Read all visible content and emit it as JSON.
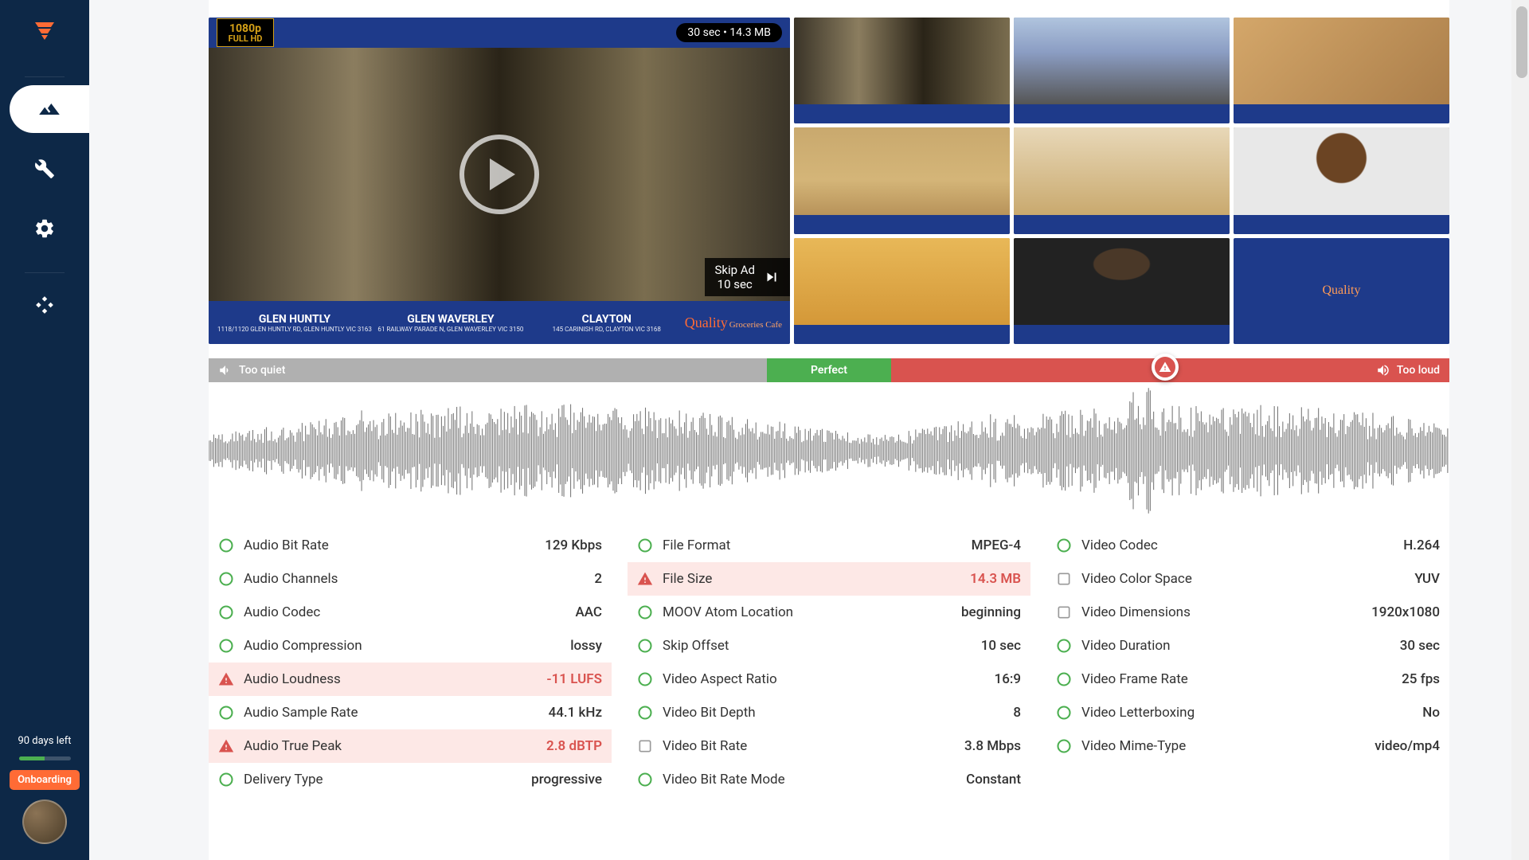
{
  "sidebar": {
    "days_left": "90 days left",
    "onboarding": "Onboarding"
  },
  "video": {
    "hd_top": "1080p",
    "hd_bottom": "FULL HD",
    "duration_pill": "30 sec • 14.3 MB",
    "skip_line1": "Skip Ad",
    "skip_line2": "10 sec",
    "loc1_name": "GLEN HUNTLY",
    "loc1_addr": "1118/1120 GLEN HUNTLY RD, GLEN HUNTLY VIC 3163",
    "loc2_name": "GLEN WAVERLEY",
    "loc2_addr": "61 RAILWAY PARADE N, GLEN WAVERLEY VIC 3150",
    "loc3_name": "CLAYTON",
    "loc3_addr": "145 CARINISH RD, CLAYTON VIC 3168",
    "brand_main": "Quality",
    "brand_sub": "Groceries Cafe"
  },
  "audio_bar": {
    "quiet": "Too quiet",
    "perfect": "Perfect",
    "loud": "Too loud"
  },
  "metadata": {
    "col1": [
      {
        "label": "Audio Bit Rate",
        "value": "129 Kbps",
        "status": "ok"
      },
      {
        "label": "Audio Channels",
        "value": "2",
        "status": "ok"
      },
      {
        "label": "Audio Codec",
        "value": "AAC",
        "status": "ok"
      },
      {
        "label": "Audio Compression",
        "value": "lossy",
        "status": "ok"
      },
      {
        "label": "Audio Loudness",
        "value": "-11 LUFS",
        "status": "warn"
      },
      {
        "label": "Audio Sample Rate",
        "value": "44.1 kHz",
        "status": "ok"
      },
      {
        "label": "Audio True Peak",
        "value": "2.8 dBTP",
        "status": "warn"
      },
      {
        "label": "Delivery Type",
        "value": "progressive",
        "status": "ok"
      }
    ],
    "col2": [
      {
        "label": "File Format",
        "value": "MPEG-4",
        "status": "ok"
      },
      {
        "label": "File Size",
        "value": "14.3 MB",
        "status": "warn"
      },
      {
        "label": "MOOV Atom Location",
        "value": "beginning",
        "status": "ok"
      },
      {
        "label": "Skip Offset",
        "value": "10 sec",
        "status": "ok"
      },
      {
        "label": "Video Aspect Ratio",
        "value": "16:9",
        "status": "ok"
      },
      {
        "label": "Video Bit Depth",
        "value": "8",
        "status": "ok"
      },
      {
        "label": "Video Bit Rate",
        "value": "3.8 Mbps",
        "status": "info"
      },
      {
        "label": "Video Bit Rate Mode",
        "value": "Constant",
        "status": "ok"
      }
    ],
    "col3": [
      {
        "label": "Video Codec",
        "value": "H.264",
        "status": "ok"
      },
      {
        "label": "Video Color Space",
        "value": "YUV",
        "status": "info"
      },
      {
        "label": "Video Dimensions",
        "value": "1920x1080",
        "status": "info"
      },
      {
        "label": "Video Duration",
        "value": "30 sec",
        "status": "ok"
      },
      {
        "label": "Video Frame Rate",
        "value": "25 fps",
        "status": "ok"
      },
      {
        "label": "Video Letterboxing",
        "value": "No",
        "status": "ok"
      },
      {
        "label": "Video Mime-Type",
        "value": "video/mp4",
        "status": "ok"
      }
    ]
  }
}
